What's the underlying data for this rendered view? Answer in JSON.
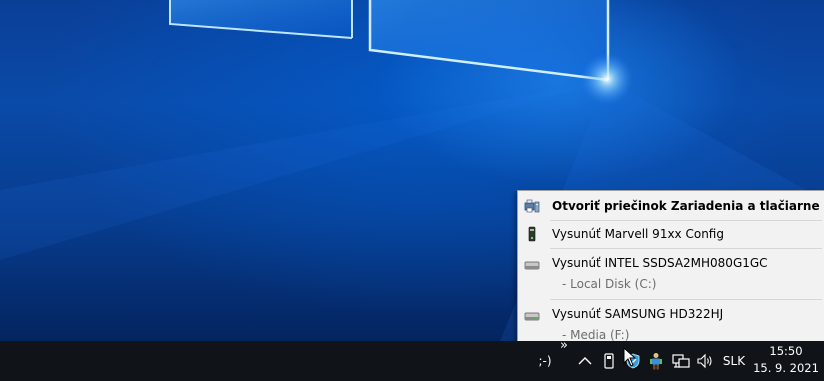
{
  "context_menu": {
    "items": [
      {
        "label": "Otvoriť priečinok Zariadenia a tlačiarne",
        "icon": "devices-printers-icon"
      },
      {
        "label": "Vysunúť Marvell 91xx Config",
        "icon": "usb-drive-icon"
      },
      {
        "label": "Vysunúť INTEL SSDSA2MH080G1GC",
        "icon": "hard-drive-icon",
        "sub": "-   Local Disk (C:)"
      },
      {
        "label": "Vysunúť SAMSUNG HD322HJ",
        "icon": "hard-drive-icon",
        "sub": "-   Media (F:)"
      }
    ]
  },
  "taskbar": {
    "tray_text": ";-)",
    "overflow_chevron": "»",
    "language": "SLK",
    "clock_time": "15:50",
    "clock_date": "15. 9. 2021",
    "tray_icons": [
      "chevron-up-icon",
      "usb-device-icon",
      "safe-remove-shield-icon",
      "person-app-icon",
      "network-icon",
      "speaker-icon"
    ]
  },
  "colors": {
    "taskbar_bg": "#101418",
    "menu_bg": "#f2f2f2",
    "wallpaper_blue": "#0a4aa8"
  }
}
